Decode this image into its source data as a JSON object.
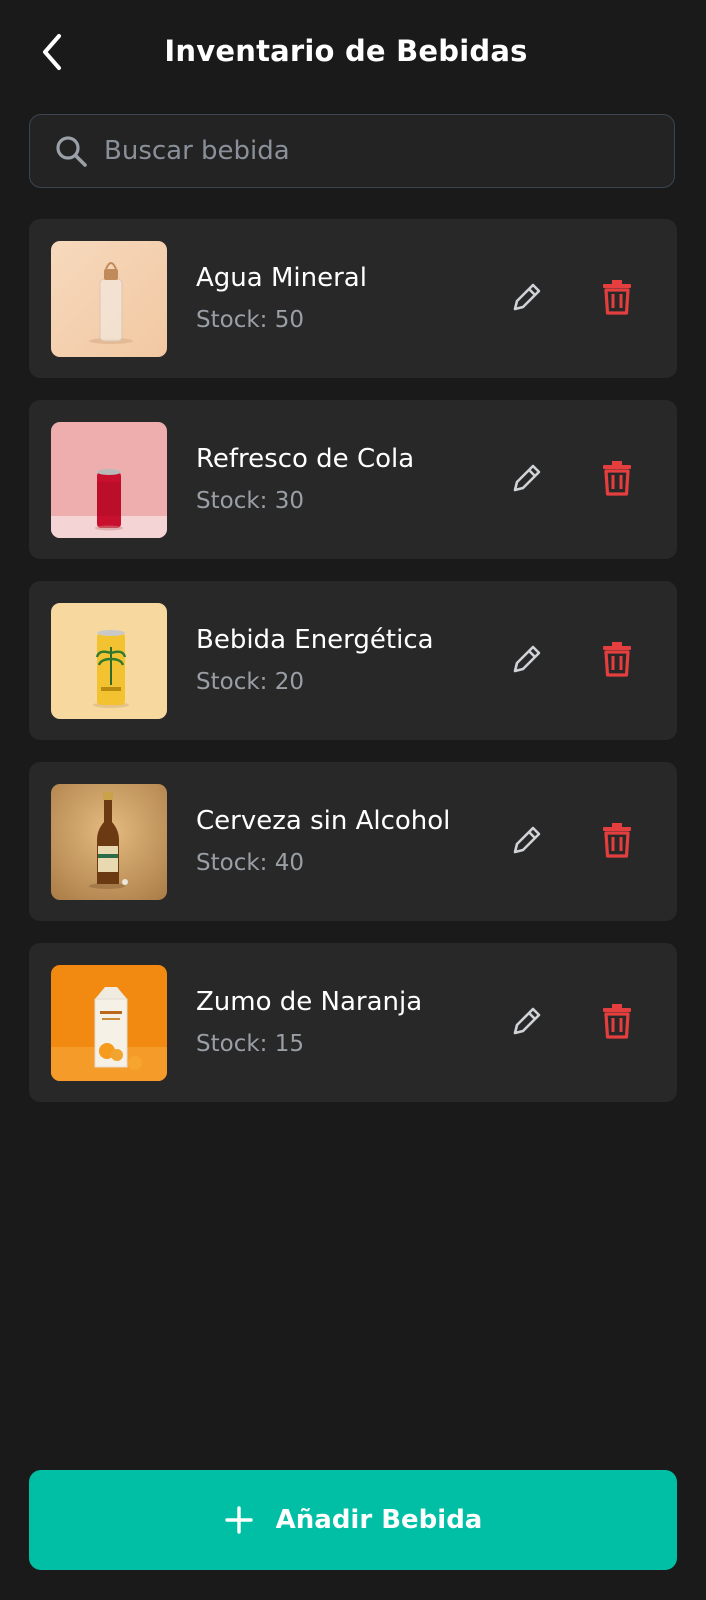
{
  "header": {
    "title": "Inventario de Bebidas",
    "back_icon": "chevron-left-icon"
  },
  "search": {
    "placeholder": "Buscar bebida",
    "value": "",
    "icon": "search-icon"
  },
  "drinks": [
    {
      "name": "Agua Mineral",
      "stock": "Stock: 50",
      "image": "water-bottle"
    },
    {
      "name": "Refresco de Cola",
      "stock": "Stock: 30",
      "image": "red-can"
    },
    {
      "name": "Bebida Energética",
      "stock": "Stock: 20",
      "image": "yellow-can"
    },
    {
      "name": "Cerveza sin Alcohol",
      "stock": "Stock: 40",
      "image": "beer-bottle"
    },
    {
      "name": "Zumo de Naranja",
      "stock": "Stock: 15",
      "image": "juice-carton"
    }
  ],
  "actions": {
    "edit_icon": "pencil-icon",
    "delete_icon": "trash-icon"
  },
  "add_button": {
    "label": "Añadir Bebida",
    "icon": "plus-icon"
  },
  "colors": {
    "background": "#1a1a1a",
    "card": "#282828",
    "accent": "#00bfa5",
    "delete": "#e53e3e",
    "muted_text": "#9a9ea5"
  }
}
